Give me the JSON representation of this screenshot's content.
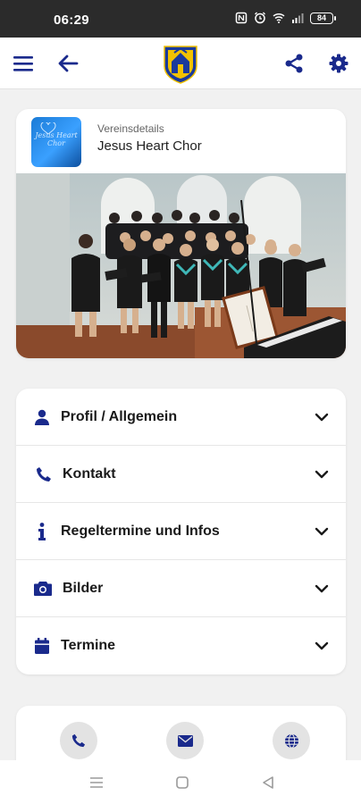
{
  "status_bar": {
    "time": "06:29",
    "battery": "84",
    "icons": [
      "nfc-icon",
      "alarm-icon",
      "wifi-icon",
      "signal-icon",
      "battery-icon"
    ]
  },
  "app_bar": {
    "left_icons": [
      "menu-icon",
      "back-arrow-icon"
    ],
    "right_icons": [
      "share-icon",
      "settings-icon"
    ],
    "logo": "municipal-coat-of-arms"
  },
  "club_card": {
    "small_label": "Vereinsdetails",
    "name": "Jesus Heart Chor",
    "thumbnail_text": "Jesus Heart Chor",
    "photo": "choir-group-photo"
  },
  "menu": {
    "items": [
      {
        "label": "Profil / Allgemein",
        "icon": "user-icon"
      },
      {
        "label": "Kontakt",
        "icon": "phone-icon"
      },
      {
        "label": "Regeltermine und Infos",
        "icon": "info-icon"
      },
      {
        "label": "Bilder",
        "icon": "camera-icon"
      },
      {
        "label": "Termine",
        "icon": "calendar-icon"
      }
    ]
  },
  "contact_buttons": [
    "phone-icon",
    "mail-icon",
    "globe-icon"
  ],
  "nav_bar": [
    "recent-apps-icon",
    "home-icon",
    "back-icon"
  ],
  "colors": {
    "accent": "#1a2a8c",
    "background": "#f1f1f1",
    "status_bar": "#2b2b2b",
    "card": "#ffffff"
  }
}
